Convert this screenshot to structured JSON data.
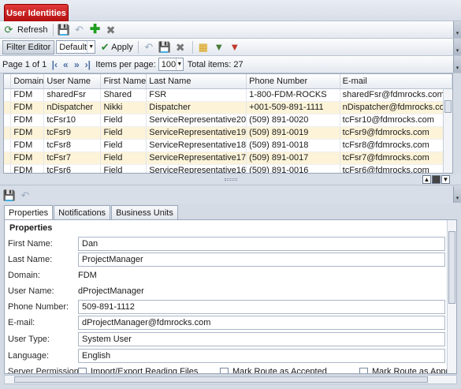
{
  "app": {
    "tab_title": "User Identities"
  },
  "toolbar1": {
    "refresh_label": "Refresh"
  },
  "filterbar": {
    "filter_editor_label": "Filter Editor",
    "view_select": "Default",
    "apply_label": "Apply"
  },
  "pager": {
    "page_text": "Page 1 of 1",
    "items_per_page_label": "Items per page:",
    "items_per_page": "100",
    "total_items": "Total items: 27"
  },
  "grid": {
    "columns": [
      "Domain",
      "User Name",
      "First Name",
      "Last Name",
      "Phone Number",
      "E-mail"
    ],
    "rows": [
      {
        "domain": "FDM",
        "user": "sharedFsr",
        "first": "Shared",
        "last": "FSR",
        "phone": "1-800-FDM-ROCKS",
        "email": "sharedFsr@fdmrocks.com"
      },
      {
        "domain": "FDM",
        "user": "nDispatcher",
        "first": "Nikki",
        "last": "Dispatcher",
        "phone": "+001-509-891-1111",
        "email": "nDispatcher@fdmrocks.com"
      },
      {
        "domain": "FDM",
        "user": "tcFsr10",
        "first": "Field",
        "last": "ServiceRepresentative20",
        "phone": "(509) 891-0020",
        "email": "tcFsr10@fdmrocks.com"
      },
      {
        "domain": "FDM",
        "user": "tcFsr9",
        "first": "Field",
        "last": "ServiceRepresentative19",
        "phone": "(509) 891-0019",
        "email": "tcFsr9@fdmrocks.com"
      },
      {
        "domain": "FDM",
        "user": "tcFsr8",
        "first": "Field",
        "last": "ServiceRepresentative18",
        "phone": "(509) 891-0018",
        "email": "tcFsr8@fdmrocks.com"
      },
      {
        "domain": "FDM",
        "user": "tcFsr7",
        "first": "Field",
        "last": "ServiceRepresentative17",
        "phone": "(509) 891-0017",
        "email": "tcFsr7@fdmrocks.com"
      },
      {
        "domain": "FDM",
        "user": "tcFsr6",
        "first": "Field",
        "last": "ServiceRepresentative16",
        "phone": "(509) 891-0016",
        "email": "tcFsr6@fdmrocks.com"
      }
    ]
  },
  "detail": {
    "tabs": [
      "Properties",
      "Notifications",
      "Business Units"
    ],
    "section_title": "Properties",
    "labels": {
      "first_name": "First Name:",
      "last_name": "Last Name:",
      "domain": "Domain:",
      "user_name": "User Name:",
      "phone": "Phone Number:",
      "email": "E-mail:",
      "user_type": "User Type:",
      "language": "Language:",
      "server_permissions": "Server Permissions:"
    },
    "values": {
      "first_name": "Dan",
      "last_name": "ProjectManager",
      "domain": "FDM",
      "user_name": "dProjectManager",
      "phone": "509-891-1112",
      "email": "dProjectManager@fdmrocks.com",
      "user_type": "System User",
      "language": "English"
    },
    "permissions": [
      "Import/Export Reading Files",
      "Mark Route as Accepted",
      "Mark Route as Approv"
    ]
  },
  "colors": {
    "tab_red": "#c81e1e",
    "alt_row": "#fcf3d9"
  }
}
